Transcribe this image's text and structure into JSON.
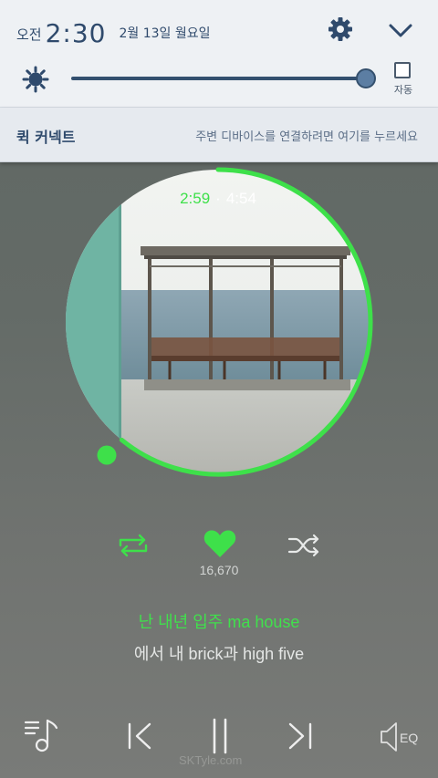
{
  "status": {
    "ampm": "오전",
    "time": "2:30",
    "date": "2월 13일 월요일"
  },
  "brightness": {
    "level_fraction": 0.99,
    "auto_label": "자동",
    "auto_checked": false
  },
  "quick_connect": {
    "title": "퀵 커넥트",
    "hint": "주변 디바이스를 연결하려면 여기를 누르세요"
  },
  "player": {
    "elapsed": "2:59",
    "separator": "·",
    "duration": "4:54",
    "progress_fraction": 0.609,
    "like_count": "16,670",
    "lyric_current": "난 내년 입주 ma house",
    "lyric_next": "에서 내 brick과 high five",
    "eq_label": "EQ",
    "watermark": "SKTyle.com"
  },
  "colors": {
    "accent_green": "#3ee04a",
    "shade_bg": "#eef1f4",
    "shade_text": "#2f4a6c"
  },
  "icons": {
    "settings": "gear-icon",
    "collapse": "chevron-down-icon",
    "brightness": "sun-icon",
    "repeat": "repeat-icon",
    "like": "heart-icon",
    "shuffle": "shuffle-icon",
    "playlist": "playlist-icon",
    "previous": "skip-previous-icon",
    "pause": "pause-icon",
    "next": "skip-next-icon",
    "equalizer": "eq-icon"
  }
}
